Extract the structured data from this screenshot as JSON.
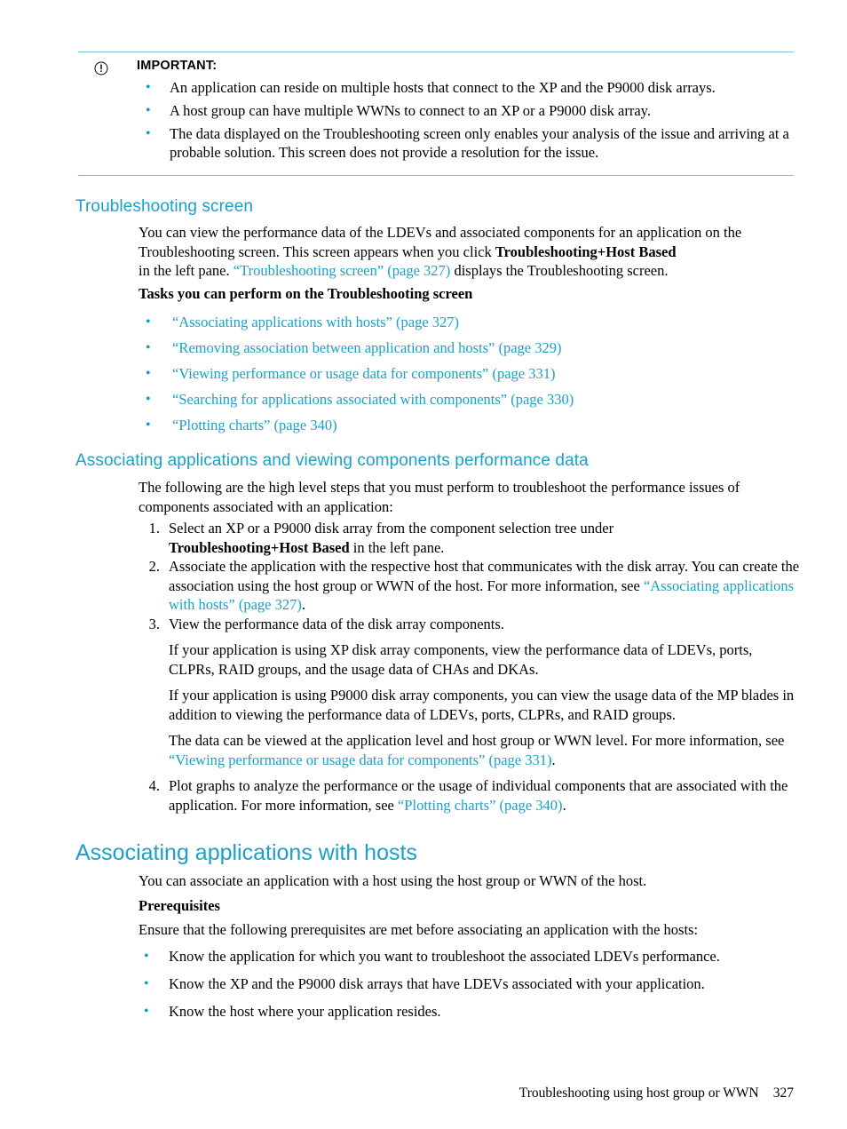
{
  "admonition": {
    "icon": "important-icon",
    "title": "IMPORTANT:",
    "items": [
      "An application can reside on multiple hosts that connect to the XP and the P9000 disk arrays.",
      "A host group can have multiple WWNs to connect to an XP or a P9000 disk array.",
      "The data displayed on the Troubleshooting screen only enables your analysis of the issue and arriving at a probable solution. This screen does not provide a resolution for the issue."
    ]
  },
  "sections": {
    "troubleshooting_screen": {
      "heading": "Troubleshooting screen",
      "para1_a": "You can view the performance data of the LDEVs and associated components for an application on the Troubleshooting screen. This screen appears when you click ",
      "para1_bold1": "Troubleshooting",
      "para1_plus": "+",
      "para1_bold2": "Host Based",
      "para1_b": "in the left pane. ",
      "para1_link": "“Troubleshooting screen” (page 327)",
      "para1_c": " displays the Troubleshooting screen.",
      "tasks_heading": "Tasks you can perform on the Troubleshooting screen",
      "task_links": [
        "“Associating applications with hosts” (page 327)",
        "“Removing association between application and hosts” (page 329)",
        "“Viewing performance or usage data for components” (page 331)",
        "“Searching for applications associated with components” (page 330)",
        "“Plotting charts” (page 340)"
      ]
    },
    "associating_and_viewing": {
      "heading": "Associating applications and viewing components performance data",
      "intro": "The following are the high level steps that you must perform to troubleshoot the performance issues of components associated with an application:",
      "step1_a": "Select an XP or a P9000 disk array from the component selection tree under ",
      "step1_bold1": "Troubleshooting",
      "step1_plus": "+",
      "step1_bold2": "Host Based",
      "step1_b": " in the left pane.",
      "step2_a": "Associate the application with the respective host that communicates with the disk array. You can create the association using the host group or WWN of the host. For more information, see ",
      "step2_link": "“Associating applications with hosts” (page 327)",
      "step2_b": ".",
      "step3": "View the performance data of the disk array components.",
      "step3_p1": "If your application is using XP disk array components, view the performance data of LDEVs, ports, CLPRs, RAID groups, and the usage data of CHAs and DKAs.",
      "step3_p2": "If your application is using P9000 disk array components, you can view the usage data of the MP blades in addition to viewing the performance data of LDEVs, ports, CLPRs, and RAID groups.",
      "step3_p3_a": "The data can be viewed at the application level and host group or WWN level. For more information, see ",
      "step3_p3_link": "“Viewing performance or usage data for components” (page 331)",
      "step3_p3_b": ".",
      "step4_a": "Plot graphs to analyze the performance or the usage of individual components that are associated with the application. For more information, see ",
      "step4_link": "“Plotting charts” (page 340)",
      "step4_b": "."
    },
    "associating_with_hosts": {
      "heading": "Associating applications with hosts",
      "intro": "You can associate an application with a host using the host group or WWN of the host.",
      "prereq_heading": "Prerequisites",
      "prereq_intro": "Ensure that the following prerequisites are met before associating an application with the hosts:",
      "prereq_items": [
        "Know the application for which you want to troubleshoot the associated LDEVs performance.",
        "Know the XP and the P9000 disk arrays that have LDEVs associated with your application.",
        "Know the host where your application resides."
      ]
    }
  },
  "footer": {
    "text": "Troubleshooting using host group or WWN",
    "page_number": "327"
  },
  "colors": {
    "link": "#1ba0c8",
    "bullet": "#00a0c6",
    "rule": "#7fbfd4"
  }
}
